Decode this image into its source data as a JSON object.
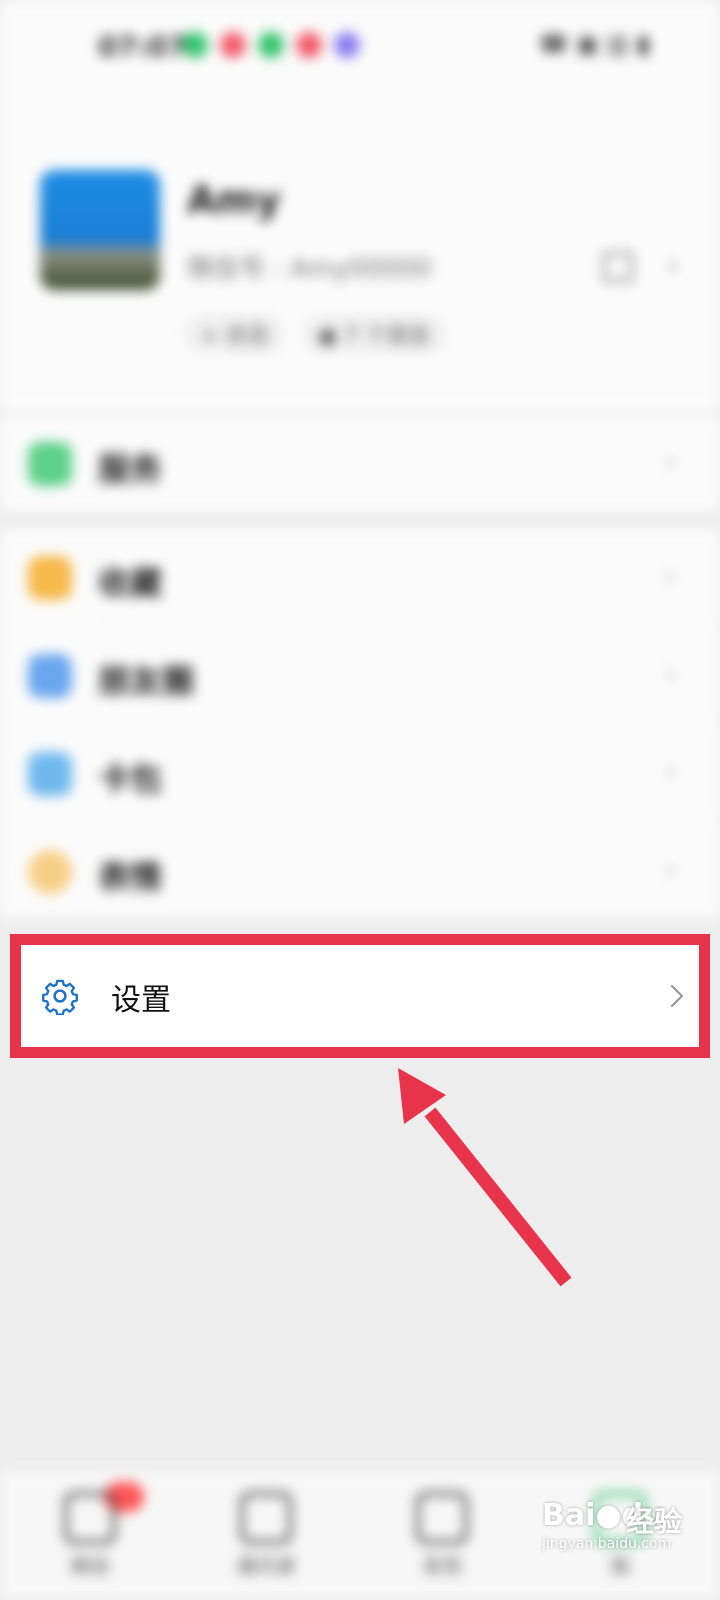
{
  "status_bar": {
    "time": "07:07",
    "dot_colors": [
      "#35c46d",
      "#f25b6a",
      "#35c46d",
      "#f25b6a",
      "#8c7cf0"
    ],
    "right": "☎ ▣ ▥ ▮"
  },
  "profile": {
    "name": "Amy",
    "id_text": "微信号 : Amy00000",
    "pills": [
      "+ 状态",
      "● 7 个朋友"
    ]
  },
  "menu": {
    "section1": [
      {
        "label": "服务",
        "icon": "service-icon",
        "color": "#5cd189"
      }
    ],
    "section2": [
      {
        "label": "收藏",
        "icon": "favorites-icon",
        "color": "#f7b94a"
      },
      {
        "label": "朋友圈",
        "icon": "moments-icon",
        "color": "#6aa6ef"
      },
      {
        "label": "卡包",
        "icon": "cards-icon",
        "color": "#6fb9ee"
      },
      {
        "label": "表情",
        "icon": "stickers-icon",
        "color": "#f7cf86"
      }
    ],
    "settings": {
      "label": "设置",
      "icon": "gear-icon",
      "color": "#1e73c9"
    }
  },
  "bottom_nav": {
    "tabs": [
      {
        "label": "微信",
        "icon": "chat-icon"
      },
      {
        "label": "通讯录",
        "icon": "contacts-icon"
      },
      {
        "label": "发现",
        "icon": "discover-icon"
      },
      {
        "label": "我",
        "icon": "me-icon"
      }
    ]
  },
  "watermark": {
    "logo_text": "Bai●du",
    "cn": "经验",
    "url": "jingyan.baidu.com"
  }
}
